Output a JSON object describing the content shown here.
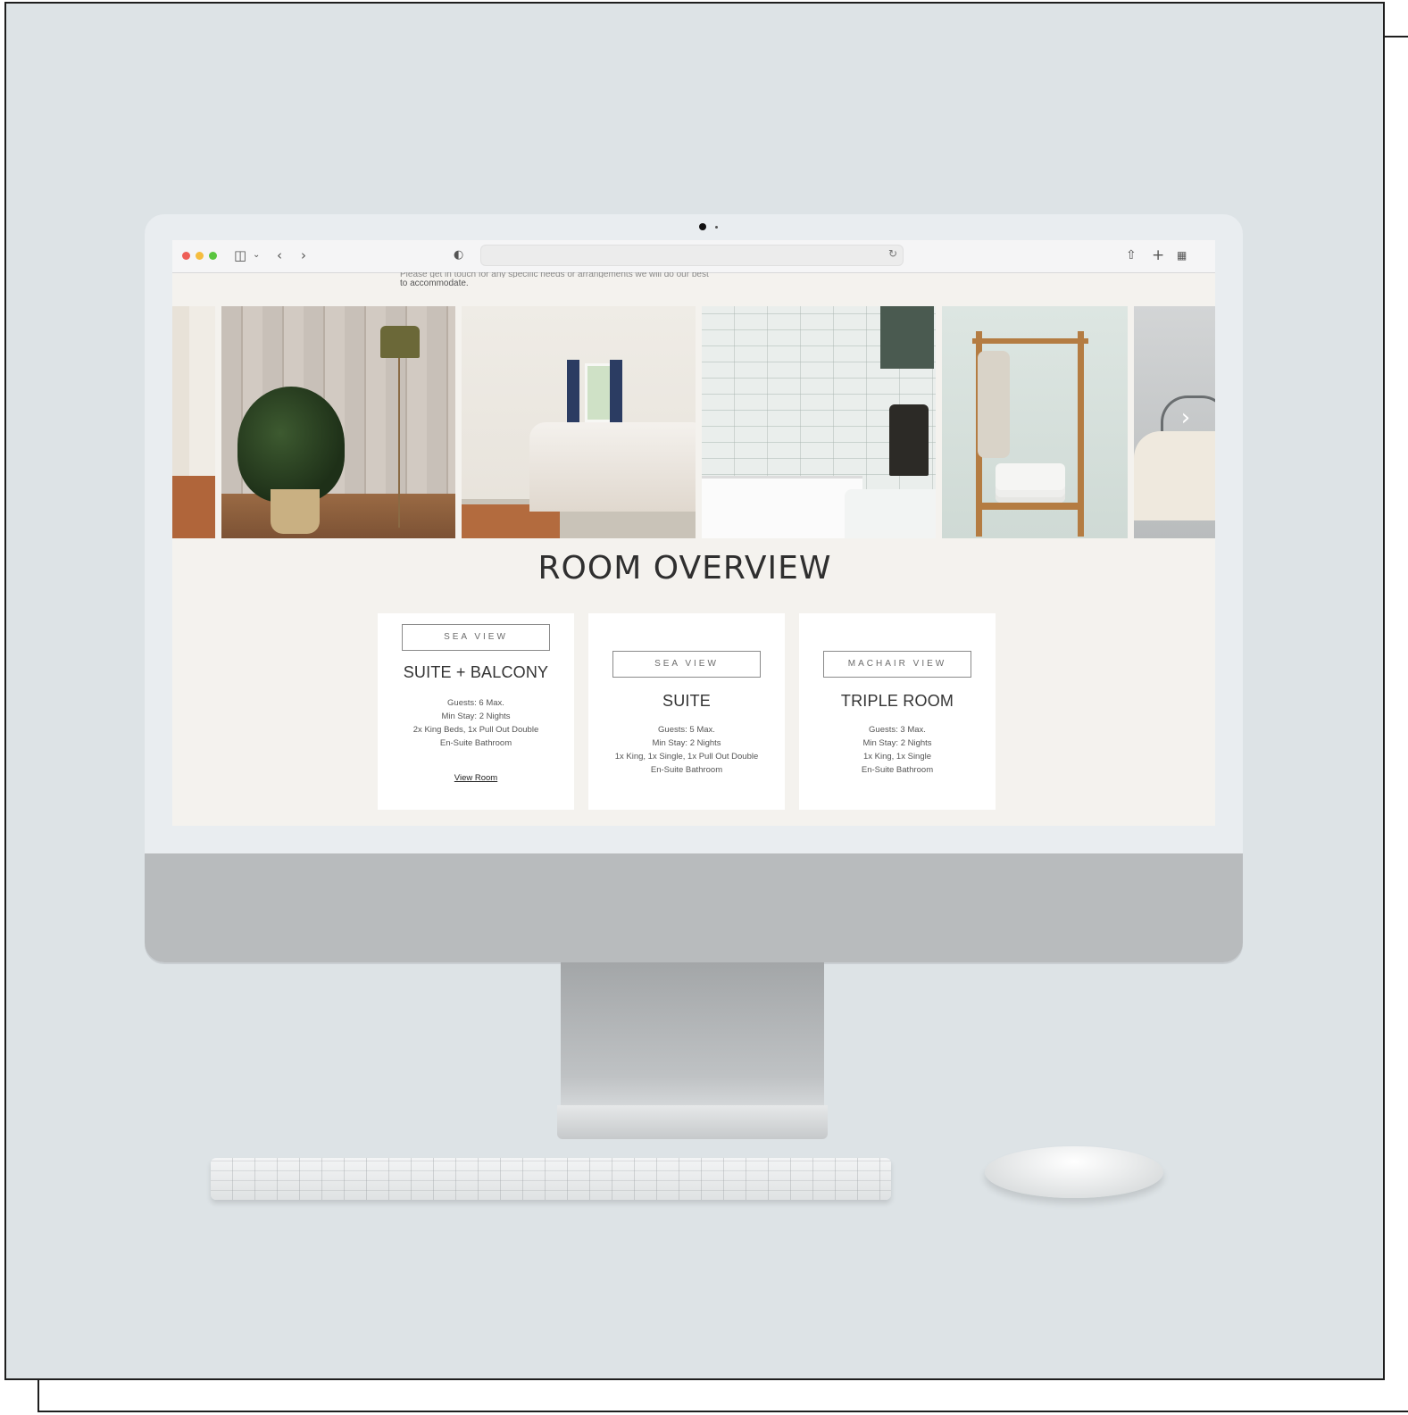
{
  "page": {
    "intro_cut": "Please get in touch for any specific needs or arrangements we will do our best",
    "intro_line": "to accommodate."
  },
  "toolbar": {
    "icons": [
      "sidebar-icon",
      "chevron-down-icon",
      "back-icon",
      "forward-icon",
      "shield-icon",
      "reload-icon",
      "share-icon",
      "new-tab-icon",
      "tab-overview-icon"
    ]
  },
  "gallery": {
    "photos": [
      "bedroom-edge",
      "plant-and-floor-lamp",
      "twin-bedroom",
      "bathroom-tiles",
      "clothes-rack-with-towels",
      "iron-bed"
    ],
    "next_icon": "›"
  },
  "section": {
    "title": "ROOM OVERVIEW"
  },
  "rooms": [
    {
      "badge": "SEA VIEW",
      "name": "SUITE + BALCONY",
      "details": [
        "Guests: 6 Max.",
        "Min Stay: 2 Nights",
        "2x King Beds, 1x Pull Out Double",
        "En-Suite Bathroom"
      ],
      "link": "View Room"
    },
    {
      "badge": "SEA VIEW",
      "name": "SUITE",
      "details": [
        "Guests: 5 Max.",
        "Min Stay: 2 Nights",
        "1x King, 1x Single, 1x Pull Out Double",
        "En-Suite Bathroom"
      ]
    },
    {
      "badge": "MACHAIR VIEW",
      "name": "TRIPLE ROOM",
      "details": [
        "Guests: 3 Max.",
        "Min Stay: 2 Nights",
        "1x King, 1x Single",
        "En-Suite Bathroom"
      ]
    }
  ],
  "colors": {
    "page_bg": "#f4f2ee",
    "card_bg": "#ffffff",
    "backdrop": "#dde3e6"
  }
}
